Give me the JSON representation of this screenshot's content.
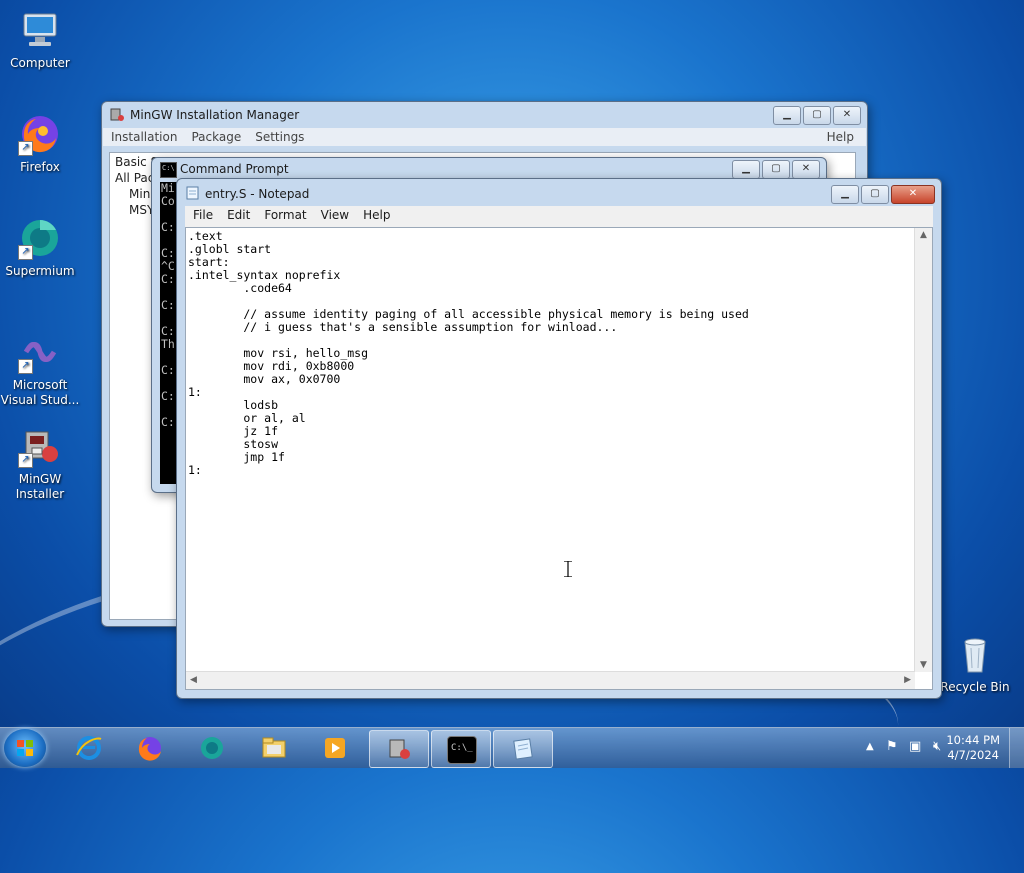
{
  "desktop": {
    "icons": [
      {
        "label": "Computer",
        "icon": "computer-icon"
      },
      {
        "label": "Firefox",
        "icon": "firefox-icon"
      },
      {
        "label": "Supermium",
        "icon": "supermium-icon"
      },
      {
        "label": "Microsoft Visual Stud...",
        "icon": "visual-studio-icon"
      },
      {
        "label": "MinGW Installer",
        "icon": "mingw-installer-icon"
      },
      {
        "label": "Recycle Bin",
        "icon": "recycle-bin-icon"
      }
    ]
  },
  "mingw": {
    "title": "MinGW Installation Manager",
    "menu": [
      "Installation",
      "Package",
      "Settings"
    ],
    "help": "Help",
    "tree": [
      "Basic S",
      "All Pac",
      "Min",
      "MSY"
    ]
  },
  "cmd": {
    "title": "Command Prompt",
    "lines": [
      "Mi",
      "Co",
      "",
      "C:",
      "",
      "C:",
      "^C",
      "C:",
      "",
      "C:",
      "",
      "C:",
      "Th",
      "",
      "C:",
      "",
      "C:",
      "",
      "C:"
    ]
  },
  "notepad": {
    "title": "entry.S - Notepad",
    "menu": [
      "File",
      "Edit",
      "Format",
      "View",
      "Help"
    ],
    "content": ".text\n.globl start\nstart:\n.intel_syntax noprefix\n        .code64\n\n        // assume identity paging of all accessible physical memory is being used\n        // i guess that's a sensible assumption for winload...\n\n        mov rsi, hello_msg\n        mov rdi, 0xb8000\n        mov ax, 0x0700\n1:\n        lodsb\n        or al, al\n        jz 1f\n        stosw\n        jmp 1f\n1:"
  },
  "taskbar": {
    "pinned": [
      "internet-explorer-icon",
      "firefox-icon",
      "supermium-icon",
      "file-explorer-icon",
      "media-player-icon"
    ],
    "running": [
      "mingw-installer-icon",
      "command-prompt-icon",
      "notepad-icon"
    ]
  },
  "tray": {
    "time": "10:44 PM",
    "date": "4/7/2024"
  },
  "colors": {
    "accent": "#1a74cd",
    "cmd_bg": "#000000",
    "cmd_fg": "#c0c0c0"
  }
}
